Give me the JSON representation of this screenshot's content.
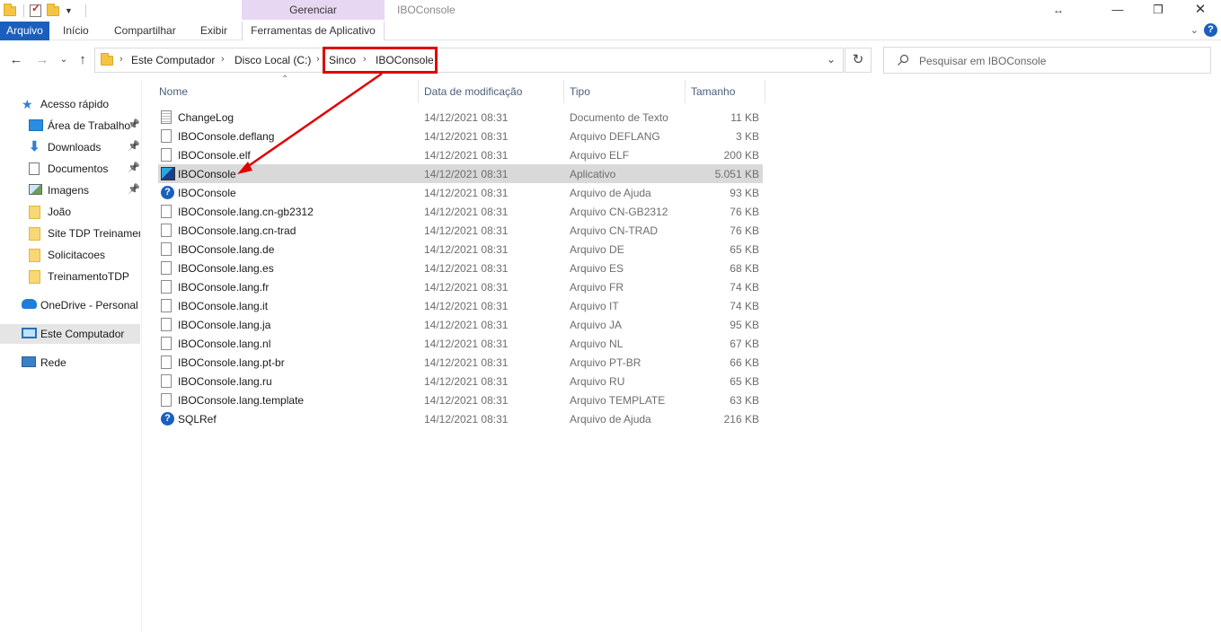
{
  "window": {
    "title": "IBOConsole",
    "context_group": "Gerenciar"
  },
  "ribbon": {
    "tabs": [
      "Arquivo",
      "Início",
      "Compartilhar",
      "Exibir",
      "Ferramentas de Aplicativo"
    ]
  },
  "breadcrumb": [
    "Este Computador",
    "Disco Local (C:)",
    "Sinco",
    "IBOConsole"
  ],
  "search": {
    "placeholder": "Pesquisar em IBOConsole"
  },
  "nav": [
    {
      "label": "Acesso rápido",
      "icon": "star-icon",
      "pinned": false,
      "indent": false,
      "selected": false
    },
    {
      "label": "Área de Trabalho",
      "icon": "desktop-icon",
      "pinned": true,
      "indent": true,
      "selected": false
    },
    {
      "label": "Downloads",
      "icon": "download-icon",
      "pinned": true,
      "indent": true,
      "selected": false
    },
    {
      "label": "Documentos",
      "icon": "documents-icon",
      "pinned": true,
      "indent": true,
      "selected": false
    },
    {
      "label": "Imagens",
      "icon": "pictures-icon",
      "pinned": true,
      "indent": true,
      "selected": false
    },
    {
      "label": "João",
      "icon": "folder-icon",
      "pinned": false,
      "indent": true,
      "selected": false
    },
    {
      "label": "Site TDP Treinamento",
      "icon": "folder-icon",
      "pinned": false,
      "indent": true,
      "selected": false
    },
    {
      "label": "Solicitacoes",
      "icon": "folder-icon",
      "pinned": false,
      "indent": true,
      "selected": false
    },
    {
      "label": "TreinamentoTDP",
      "icon": "folder-icon",
      "pinned": false,
      "indent": true,
      "selected": false
    },
    {
      "label": "OneDrive - Personal",
      "icon": "cloud-icon",
      "pinned": false,
      "indent": false,
      "selected": false
    },
    {
      "label": "Este Computador",
      "icon": "computer-icon",
      "pinned": false,
      "indent": false,
      "selected": true
    },
    {
      "label": "Rede",
      "icon": "network-icon",
      "pinned": false,
      "indent": false,
      "selected": false
    }
  ],
  "columns": {
    "name": "Nome",
    "date": "Data de modificação",
    "type": "Tipo",
    "size": "Tamanho"
  },
  "files": [
    {
      "name": "ChangeLog",
      "date": "14/12/2021 08:31",
      "type": "Documento de Texto",
      "size": "11 KB",
      "icon": "text-file-icon",
      "selected": false
    },
    {
      "name": "IBOConsole.deflang",
      "date": "14/12/2021 08:31",
      "type": "Arquivo DEFLANG",
      "size": "3 KB",
      "icon": "file-icon",
      "selected": false
    },
    {
      "name": "IBOConsole.elf",
      "date": "14/12/2021 08:31",
      "type": "Arquivo ELF",
      "size": "200 KB",
      "icon": "file-icon",
      "selected": false
    },
    {
      "name": "IBOConsole",
      "date": "14/12/2021 08:31",
      "type": "Aplicativo",
      "size": "5.051 KB",
      "icon": "application-icon",
      "selected": true
    },
    {
      "name": "IBOConsole",
      "date": "14/12/2021 08:31",
      "type": "Arquivo de Ajuda",
      "size": "93 KB",
      "icon": "help-file-icon",
      "selected": false
    },
    {
      "name": "IBOConsole.lang.cn-gb2312",
      "date": "14/12/2021 08:31",
      "type": "Arquivo CN-GB2312",
      "size": "76 KB",
      "icon": "file-icon",
      "selected": false
    },
    {
      "name": "IBOConsole.lang.cn-trad",
      "date": "14/12/2021 08:31",
      "type": "Arquivo CN-TRAD",
      "size": "76 KB",
      "icon": "file-icon",
      "selected": false
    },
    {
      "name": "IBOConsole.lang.de",
      "date": "14/12/2021 08:31",
      "type": "Arquivo DE",
      "size": "65 KB",
      "icon": "file-icon",
      "selected": false
    },
    {
      "name": "IBOConsole.lang.es",
      "date": "14/12/2021 08:31",
      "type": "Arquivo ES",
      "size": "68 KB",
      "icon": "file-icon",
      "selected": false
    },
    {
      "name": "IBOConsole.lang.fr",
      "date": "14/12/2021 08:31",
      "type": "Arquivo FR",
      "size": "74 KB",
      "icon": "file-icon",
      "selected": false
    },
    {
      "name": "IBOConsole.lang.it",
      "date": "14/12/2021 08:31",
      "type": "Arquivo IT",
      "size": "74 KB",
      "icon": "file-icon",
      "selected": false
    },
    {
      "name": "IBOConsole.lang.ja",
      "date": "14/12/2021 08:31",
      "type": "Arquivo JA",
      "size": "95 KB",
      "icon": "file-icon",
      "selected": false
    },
    {
      "name": "IBOConsole.lang.nl",
      "date": "14/12/2021 08:31",
      "type": "Arquivo NL",
      "size": "67 KB",
      "icon": "file-icon",
      "selected": false
    },
    {
      "name": "IBOConsole.lang.pt-br",
      "date": "14/12/2021 08:31",
      "type": "Arquivo PT-BR",
      "size": "66 KB",
      "icon": "file-icon",
      "selected": false
    },
    {
      "name": "IBOConsole.lang.ru",
      "date": "14/12/2021 08:31",
      "type": "Arquivo RU",
      "size": "65 KB",
      "icon": "file-icon",
      "selected": false
    },
    {
      "name": "IBOConsole.lang.template",
      "date": "14/12/2021 08:31",
      "type": "Arquivo TEMPLATE",
      "size": "63 KB",
      "icon": "file-icon",
      "selected": false
    },
    {
      "name": "SQLRef",
      "date": "14/12/2021 08:31",
      "type": "Arquivo de Ajuda",
      "size": "216 KB",
      "icon": "help-file-icon",
      "selected": false
    }
  ],
  "annotation": {
    "color": "#e00000"
  },
  "colors": {
    "accent": "#1b5fbd",
    "context_tab": "#e7d7f2",
    "selection": "#d9d9d9"
  }
}
